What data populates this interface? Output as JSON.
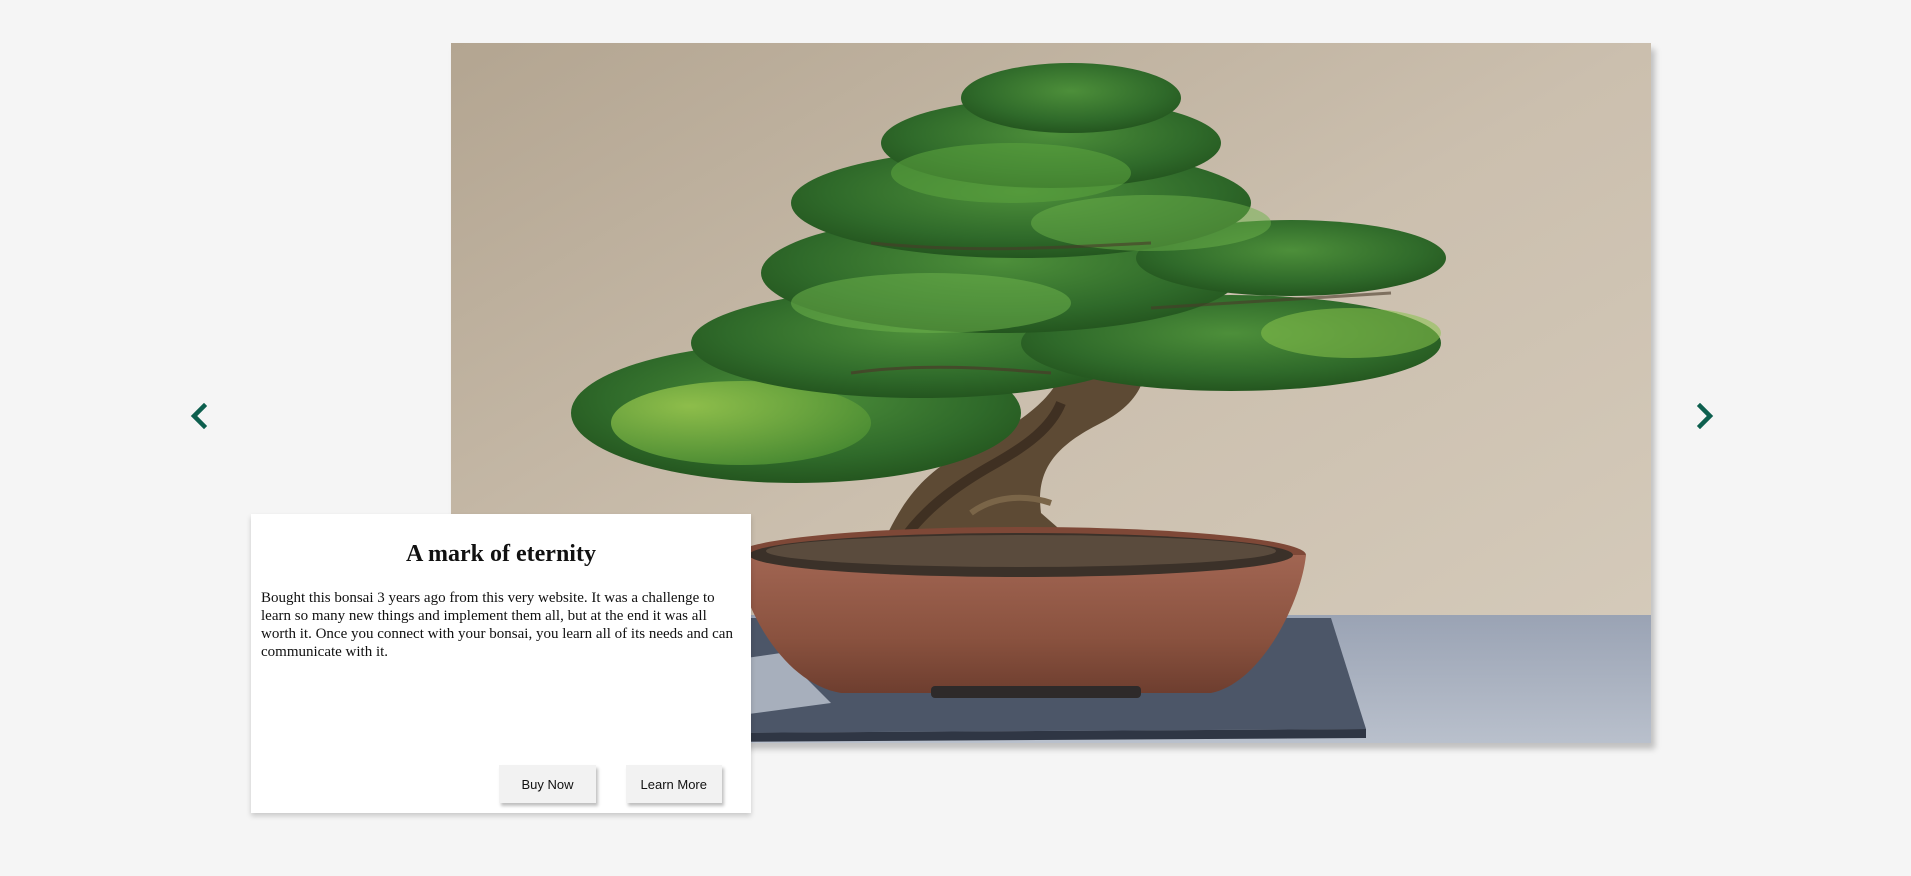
{
  "carousel": {
    "prev_icon": "chevron-left-icon",
    "next_icon": "chevron-right-icon",
    "accent_color": "#0d5f4e",
    "slide": {
      "image_subject": "bonsai-photo",
      "title": "A mark of eternity",
      "text": "Bought this bonsai 3 years ago from this very website. It was a challenge to learn so many new things and implement them all, but at the end it was all worth it. Once you connect with your bonsai, you learn all of its needs and can communicate with it.",
      "buttons": {
        "buy_label": "Buy Now",
        "learn_label": "Learn More"
      }
    }
  }
}
